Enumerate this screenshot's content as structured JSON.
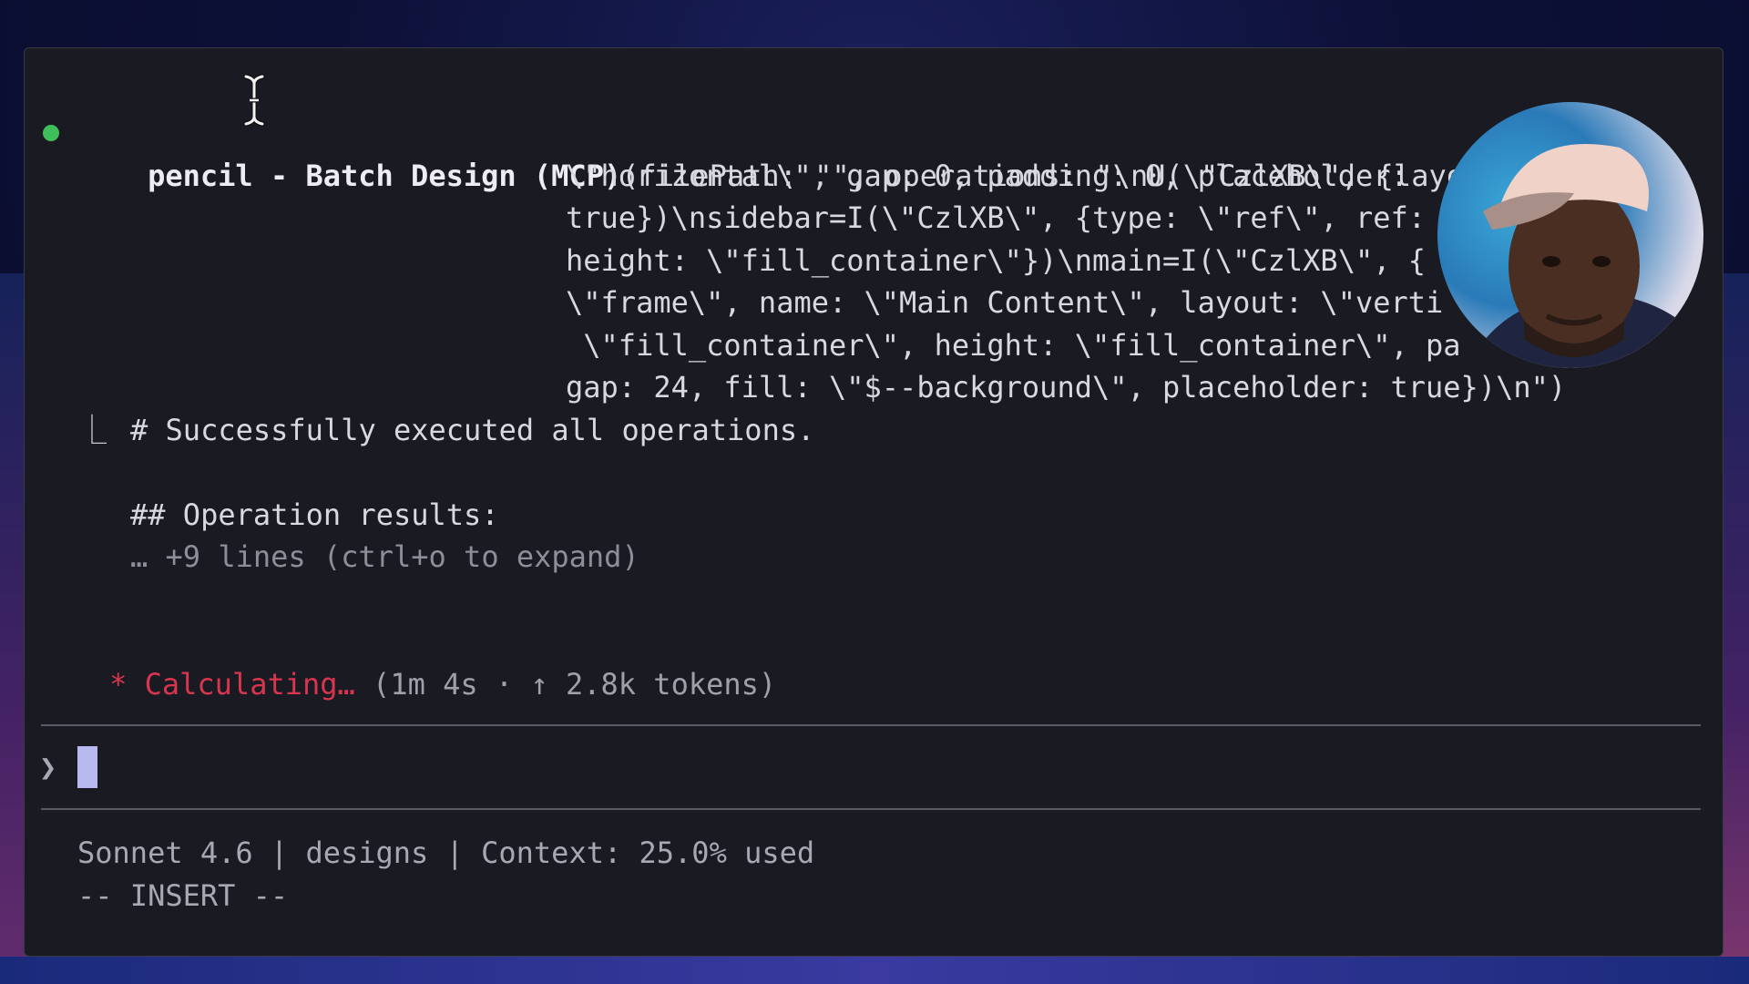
{
  "tool_call": {
    "status_color": "#3fbf5a",
    "name": "pencil - Batch Design (MCP)",
    "args_lines": [
      "(filePath: \"\", operations: \"\\nU(\\\"CzlXB\\\", {layout:",
      "\\\"horizontal\\\", gap: 0, padding: 0, placeholder:",
      "true})\\nsidebar=I(\\\"CzlXB\\\", {type: \\\"ref\\\", ref:",
      "height: \\\"fill_container\\\"})\\nmain=I(\\\"CzlXB\\\", {",
      "\\\"frame\\\", name: \\\"Main Content\\\", layout: \\\"verti",
      " \\\"fill_container\\\", height: \\\"fill_container\\\", pa",
      "gap: 24, fill: \\\"$--background\\\", placeholder: true})\\n\")"
    ]
  },
  "result": {
    "tree_glyph": "⎿",
    "summary": "# Successfully executed all operations.",
    "heading": "## Operation results:",
    "collapsed": "… +9 lines (ctrl+o to expand)"
  },
  "activity": {
    "spinner": "*",
    "label": "Calculating…",
    "stats": "(1m 4s · ↑ 2.8k tokens)"
  },
  "prompt": {
    "chevron": "❯",
    "value": ""
  },
  "statusline": {
    "info": "Sonnet 4.6 | designs | Context: 25.0% used",
    "mode": "-- INSERT --"
  }
}
